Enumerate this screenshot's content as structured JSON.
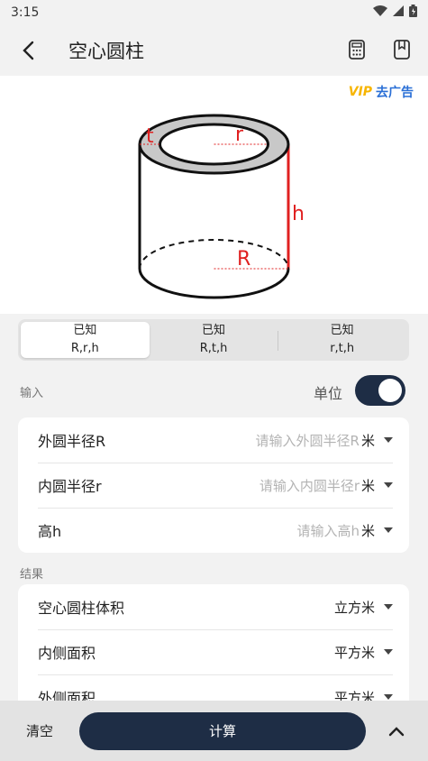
{
  "status": {
    "time": "3:15"
  },
  "header": {
    "title": "空心圆柱"
  },
  "figure": {
    "vip_tag": "VIP",
    "vip_text": "去广告",
    "labels": {
      "t": "t",
      "r": "r",
      "h": "h",
      "R": "R"
    }
  },
  "segments": [
    {
      "line1": "已知",
      "line2": "R,r,h",
      "active": true
    },
    {
      "line1": "已知",
      "line2": "R,t,h",
      "active": false
    },
    {
      "line1": "已知",
      "line2": "r,t,h",
      "active": false
    }
  ],
  "input_section": {
    "label": "输入",
    "unit_toggle_label": "单位",
    "unit_toggle_on": true,
    "rows": [
      {
        "label": "外圆半径R",
        "placeholder": "请输入外圆半径R",
        "unit": "米"
      },
      {
        "label": "内圆半径r",
        "placeholder": "请输入内圆半径r",
        "unit": "米"
      },
      {
        "label": "高h",
        "placeholder": "请输入高h",
        "unit": "米"
      }
    ]
  },
  "result_section": {
    "label": "结果",
    "rows": [
      {
        "label": "空心圆柱体积",
        "unit": "立方米"
      },
      {
        "label": "内侧面积",
        "unit": "平方米"
      },
      {
        "label": "外侧面积",
        "unit": "平方米"
      }
    ]
  },
  "bottom": {
    "clear_label": "清空",
    "calc_label": "计算"
  },
  "colors": {
    "accent": "#1e2d45",
    "annotation": "#e02020",
    "vip_gold": "#f7b500",
    "vip_blue": "#2a6fd6"
  }
}
